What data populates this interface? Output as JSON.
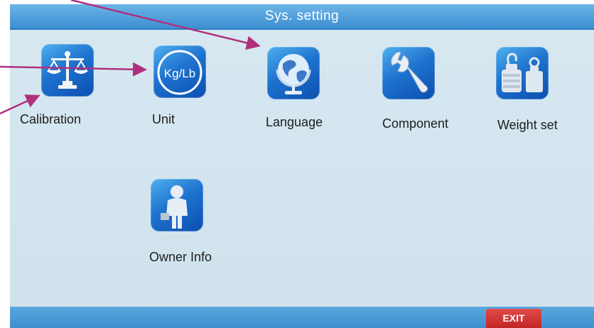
{
  "title": "Sys. setting",
  "icons": [
    {
      "id": "calibration",
      "label": "Calibration",
      "icon": "balance-scale-icon"
    },
    {
      "id": "unit",
      "label": "Unit",
      "icon": "kg-lb-icon",
      "icon_text": "Kg/Lb"
    },
    {
      "id": "language",
      "label": "Language",
      "icon": "globe-icon"
    },
    {
      "id": "component",
      "label": "Component",
      "icon": "wrench-icon"
    },
    {
      "id": "weight_set",
      "label": "Weight set",
      "icon": "weights-icon"
    },
    {
      "id": "owner_info",
      "label": "Owner Info",
      "icon": "person-icon"
    }
  ],
  "exit_label": "EXIT",
  "colors": {
    "accent": "#3d8fd2",
    "tile": "#1f73cf",
    "exit": "#d03333",
    "arrow": "#b0307e",
    "background": "#d3e5ef"
  }
}
